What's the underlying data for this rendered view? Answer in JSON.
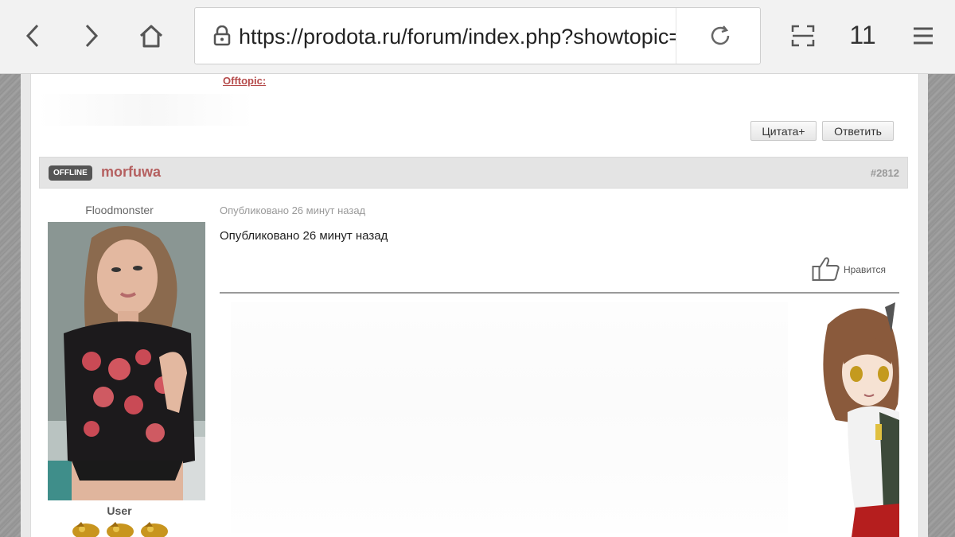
{
  "browser": {
    "url": "https://prodota.ru/forum/index.php?showtopic=",
    "tab_count": "11",
    "icons": [
      "back-icon",
      "forward-icon",
      "home-icon",
      "lock-icon",
      "reload-icon",
      "scan-icon",
      "menu-icon"
    ]
  },
  "page": {
    "offtopic_label": "Offtopic:",
    "quote_button": "Цитата+",
    "reply_button": "Ответить"
  },
  "post": {
    "status_badge": "OFFLINE",
    "username": "morfuwa",
    "post_number": "#2812",
    "user_title": "Floodmonster",
    "user_group": "User",
    "meta": "Опубликовано 26 минут назад",
    "body": "Опубликовано 26 минут назад",
    "like_label": "Нравится"
  },
  "colors": {
    "username": "#b56060",
    "offtopic": "#b54a4a",
    "badge_bg": "#555555"
  }
}
